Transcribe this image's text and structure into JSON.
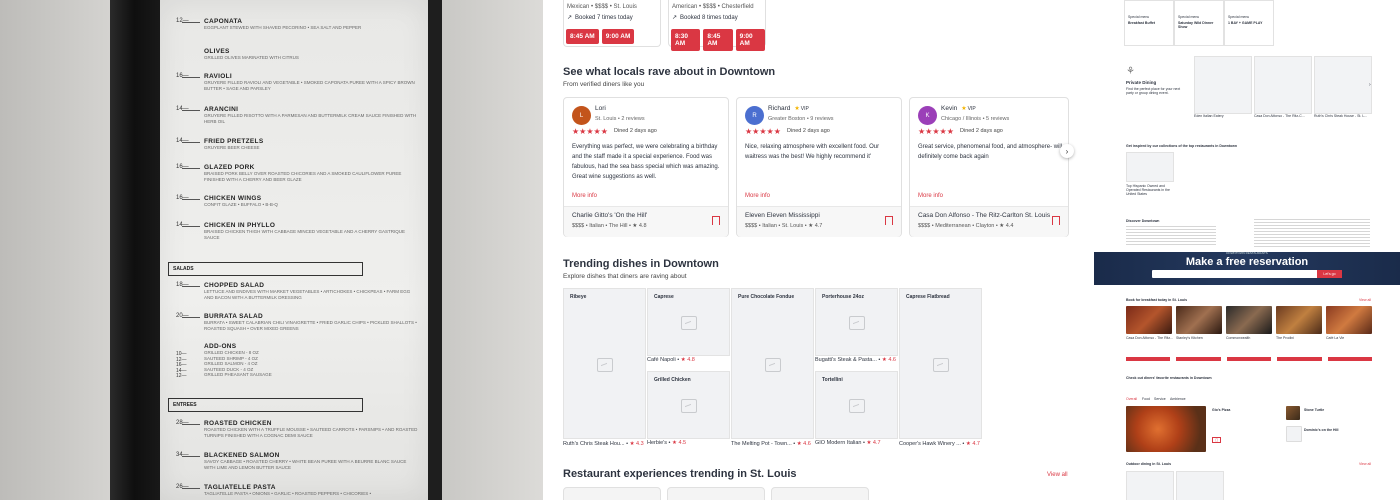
{
  "menu_photo": {
    "items": [
      {
        "price": "12—",
        "name": "CAPONATA",
        "desc": "EGGPLANT STEWED WITH SHAVED PECORINO • SEA SALT AND PEPPER"
      },
      {
        "price": "",
        "name": "OLIVES",
        "desc": "GRILLED OLIVES MARINATED WITH CITRUS"
      },
      {
        "price": "16—",
        "name": "RAVIOLI",
        "desc": "GRUYERE FILLED RAVIOLI AND VEGETABLE • SMOKED CAPONATA PUREE WITH A SPICY BROWN BUTTER • SAGE AND PARSLEY"
      },
      {
        "price": "14—",
        "name": "ARANCINI",
        "desc": "GRUYERE FILLED RISOTTO WITH A PARMESAN AND BUTTERMILK CREAM SAUCE FINISHED WITH HERB OIL"
      },
      {
        "price": "14—",
        "name": "FRIED PRETZELS",
        "desc": "GRUYERE BEER CHEESE"
      },
      {
        "price": "16—",
        "name": "GLAZED PORK",
        "desc": "BRAISED PORK BELLY OVER ROASTED CHICORIES AND A SMOKED CAULIFLOWER PUREE FINISHED WITH A CHERRY AND BEER GLAZE"
      },
      {
        "price": "16—",
        "name": "CHICKEN WINGS",
        "desc": "CONFIT GLAZE • BUFFALO • B-B-Q"
      },
      {
        "price": "14—",
        "name": "CHICKEN IN PHYLLO",
        "desc": "BRAISED CHICKEN THIGH WITH CABBAGE MINCED VEGETABLE AND A CHERRY GASTRIQUE SAUCE"
      }
    ],
    "section_salads": "SALADS",
    "salads": [
      {
        "price": "18—",
        "name": "CHOPPED SALAD",
        "desc": "LETTUCE AND ENDIVES WITH MARKET VEGETABLES • ARTICHOKES • CHICKPEAS • FARM EGG AND BACON WITH A BUTTERMILK DRESSING"
      },
      {
        "price": "20—",
        "name": "BURRATA SALAD",
        "desc": "BURRATA • SWEET CALABRIAN CHILI VINAIGRETTE • FRIED GARLIC CHIPS • PICKLED SHALLOTS • ROASTED SQUASH • OVER MIXED GREENS"
      }
    ],
    "addons_title": "ADD-ONS",
    "addons": [
      "GRILLED CHICKEN - 8 OZ",
      "SAUTEED SHRIMP - 4 OZ",
      "GRILLED SALMON - 4 OZ",
      "SAUTEED DUCK - 4 OZ",
      "GRILLED PHEASANT SAUSAGE"
    ],
    "addon_prices": [
      "10—",
      "12—",
      "16—",
      "14—",
      "12—"
    ],
    "section_entrees": "ENTREES",
    "entrees": [
      {
        "price": "28—",
        "name": "ROASTED CHICKEN",
        "desc": "ROASTED CHICKEN WITH A TRUFFLE MOUSSE • SAUTEED CARROTS • PARSNIPS • AND ROASTED TURNIPS FINISHED WITH A COGNAC DEMI SAUCE"
      },
      {
        "price": "34—",
        "name": "BLACKENED SALMON",
        "desc": "SAVOY CABBAGE • ROASTED CHERRY • WHITE BEAN PUREE WITH A BEURRE BLANC SAUCE WITH LIME AND LEMON BUTTER SAUCE"
      },
      {
        "price": "26—",
        "name": "TAGLIATELLE PASTA",
        "desc": "TAGLIATELLE PASTA • ONIONS • GARLIC • ROASTED PEPPERS • CHICORIES •"
      }
    ]
  },
  "top_cards": [
    {
      "meta": "Mexican • $$$$ • St. Louis",
      "booked": "Booked 7 times today",
      "slots": [
        "8:45 AM",
        "9:00 AM"
      ]
    },
    {
      "meta": "American • $$$$ • Chesterfield",
      "booked": "Booked 8 times today",
      "slots": [
        "8:30 AM",
        "8:45 AM",
        "9:00 AM"
      ]
    }
  ],
  "reviews_section": {
    "title": "See what locals rave about in Downtown",
    "subtitle": "From verified diners like you",
    "reviews": [
      {
        "initial": "L",
        "color": "#c3541b",
        "name": "Lori",
        "vip": "",
        "loc": "St. Louis • 2 reviews",
        "stars": "★★★★★",
        "dined": "Dined 2 days ago",
        "text": "Everything was perfect, we were celebrating a birthday and the staff made it a special experience. Food was fabulous, had the sea bass special which was amazing. Great wine suggestions as well.",
        "more": "More info",
        "rest_name": "Charlie Gitto's 'On the Hill'",
        "rest_meta": "$$$$ • Italian • The Hill • ★ 4.8"
      },
      {
        "initial": "R",
        "color": "#4b6fd0",
        "name": "Richard",
        "vip": "VIP",
        "loc": "Greater Boston • 9 reviews",
        "stars": "★★★★★",
        "dined": "Dined 2 days ago",
        "text": "Nice, relaxing atmosphere with excellent food. Our waitress was the best! We highly recommend it'",
        "more": "More info",
        "rest_name": "Eleven Eleven Mississippi",
        "rest_meta": "$$$$ • Italian • St. Louis • ★ 4.7"
      },
      {
        "initial": "K",
        "color": "#9b3fb8",
        "name": "Kevin",
        "vip": "VIP",
        "loc": "Chicago / Illinois • 5 reviews",
        "stars": "★★★★★",
        "dined": "Dined 2 days ago",
        "text": "Great service, phenomenal food, and atmosphere- will definitely come back again",
        "more": "More info",
        "rest_name": "Casa Don Alfonso - The Ritz-Carlton St. Louis",
        "rest_meta": "$$$$ • Mediterranean • Clayton • ★ 4.4"
      }
    ]
  },
  "trending": {
    "title": "Trending dishes in Downtown",
    "subtitle": "Explore dishes that diners are raving about",
    "dishes": [
      {
        "label": "Ribeye",
        "caption": "Ruth's Chris Steak Hou...",
        "rating": "★ 4.3"
      },
      {
        "label": "Caprese",
        "caption": "Café Napoli",
        "rating": "★ 4.8"
      },
      {
        "label": "Grilled Chicken",
        "caption": "Herbie's",
        "rating": "★ 4.5"
      },
      {
        "label": "Pure Chocolate Fondue",
        "caption": "The Melting Pot - Town...",
        "rating": "★ 4.6"
      },
      {
        "label": "Porterhouse 24oz",
        "caption": "Bugatti's Steak & Pasta...",
        "rating": "★ 4.6"
      },
      {
        "label": "Tortellini",
        "caption": "GIO Modern Italian",
        "rating": "★ 4.7"
      },
      {
        "label": "Caprese Flatbread",
        "caption": "Cooper's Hawk Winery ...",
        "rating": "★ 4.7"
      }
    ]
  },
  "experiences": {
    "title": "Restaurant experiences trending in St. Louis",
    "view_all": "View all"
  },
  "right_panel": {
    "specials": [
      "Special menu",
      "Special menu",
      "Special menu"
    ],
    "special_titles": [
      "Breakfast Buffet",
      "Saturday Wild Dinner Show",
      "1 BAY + GAME PLAY"
    ],
    "private_dining": "Private Dining",
    "private_sub": "Find the perfect place for your next party or group dining event.",
    "pd_cards": [
      "Eden Italian Eatery",
      "Casa Don Alfonso - The Ritz-C...",
      "Ruth's Chris Steak House - St. L..."
    ],
    "inspired": "Get inspired by our collections of the top restaurants in Downtown",
    "collection": "Top Hispanic Owned and Operated Restaurants in the United States",
    "discover": "Discover Downtown",
    "banner_small": "DOWNTOWN RESTAURANTS",
    "banner_title": "Make a free reservation",
    "banner_btn": "Let's go",
    "breakfast": "Book for breakfast today in St. Louis",
    "breakfast_cards": [
      "Casa Don Alfonso - The Ritz...",
      "Stanley's Kitchen",
      "Commonwealth",
      "The Prodini",
      "Café La Vie"
    ],
    "favorites": "Check out diners' favorite restaurants in Downtown",
    "fav_tabs": [
      "Overall",
      "Food",
      "Service",
      "Ambience"
    ],
    "fav_left": "Gio's Pizza",
    "fav_right": [
      "Stone Turtle",
      "Dominic's on the Hill"
    ],
    "outdoor": "Outdoor dining in St. Louis",
    "view_all": "View all"
  }
}
